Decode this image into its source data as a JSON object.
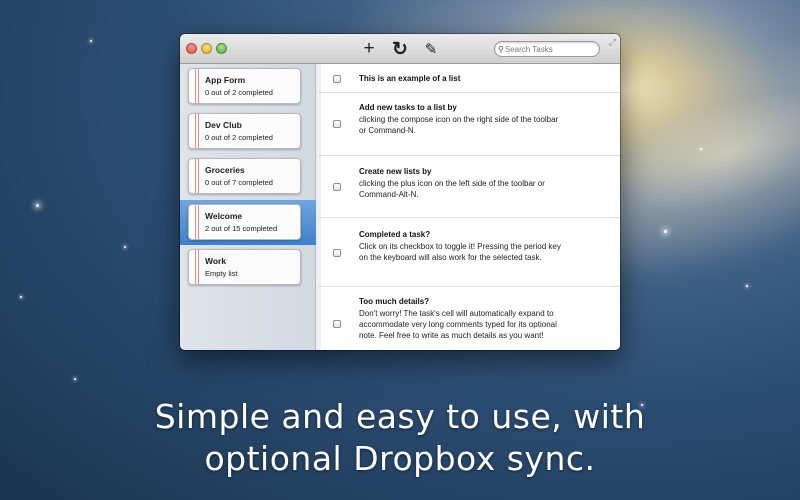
{
  "toolbar": {
    "add_icon": "plus-icon",
    "add_glyph": "+",
    "sync_icon": "refresh-icon",
    "sync_glyph": "↻",
    "compose_icon": "compose-icon",
    "compose_glyph": "✎",
    "search_placeholder": "Search Tasks",
    "search_icon_glyph": "⚲"
  },
  "lists": [
    {
      "title": "App Form",
      "subtitle": "0 out of 2 completed",
      "selected": false
    },
    {
      "title": "Dev Club",
      "subtitle": "0 out of 2 completed",
      "selected": false
    },
    {
      "title": "Groceries",
      "subtitle": "0 out of 7 completed",
      "selected": false
    },
    {
      "title": "Welcome",
      "subtitle": "2 out of 15 completed",
      "selected": true
    },
    {
      "title": "Work",
      "subtitle": "Empty list",
      "selected": false
    }
  ],
  "tasks": [
    {
      "title": "This is an example of a list",
      "note": "",
      "checked": false
    },
    {
      "title": "Add new tasks to a list by",
      "note": "clicking the compose icon on the right side of the toolbar\nor Command-N.",
      "checked": false
    },
    {
      "title": "Create new lists by",
      "note": "clicking the plus icon on the left side of the toolbar or\nCommand-Alt-N.",
      "checked": false
    },
    {
      "title": "Completed a task?",
      "note": "Click on its checkbox to toggle it! Pressing the period key\non the keyboard will also work for the selected task.",
      "checked": false
    },
    {
      "title": "Too much details?",
      "note": "Don't worry! The task's cell will automatically expand to\naccommodate very long comments typed for its optional\nnote. Feel free to write as much details as you want!",
      "checked": false
    }
  ],
  "caption": {
    "line1": "Simple and easy to use, with",
    "line2": "optional Dropbox sync."
  }
}
